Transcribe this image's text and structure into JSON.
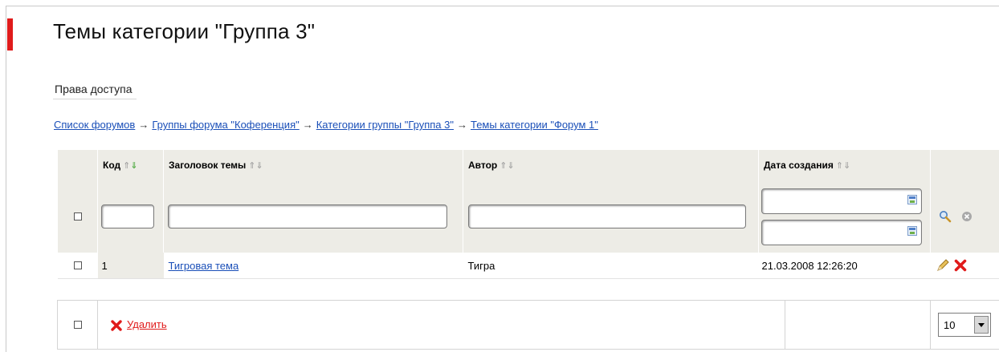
{
  "page": {
    "title": "Темы категории \"Группа 3\"",
    "access_tab": "Права доступа"
  },
  "breadcrumb": {
    "items": [
      "Список форумов",
      "Группы форума \"Коференция\"",
      "Категории группы \"Группа 3\"",
      "Темы категории \"Форум 1\""
    ],
    "separator": "→"
  },
  "table": {
    "columns": {
      "code": "Код",
      "title": "Заголовок темы",
      "author": "Автор",
      "created": "Дата создания"
    },
    "sort_up": "⇑",
    "sort_down": "⇓",
    "filter": {
      "code": "",
      "title": "",
      "author": "",
      "date_from": "",
      "date_to": ""
    },
    "rows": [
      {
        "code": "1",
        "title": "Тигровая тема",
        "author": "Тигра",
        "created": "21.03.2008 12:26:20"
      }
    ]
  },
  "footer": {
    "delete_label": "Удалить",
    "page_size": "10"
  },
  "colors": {
    "accent_red": "#e01b1b",
    "link_blue": "#1a4fb8",
    "header_bg": "#edece6"
  },
  "icons": [
    "calendar-icon",
    "search-icon",
    "clear-icon",
    "edit-icon",
    "delete-icon",
    "dropdown-arrow-icon"
  ]
}
